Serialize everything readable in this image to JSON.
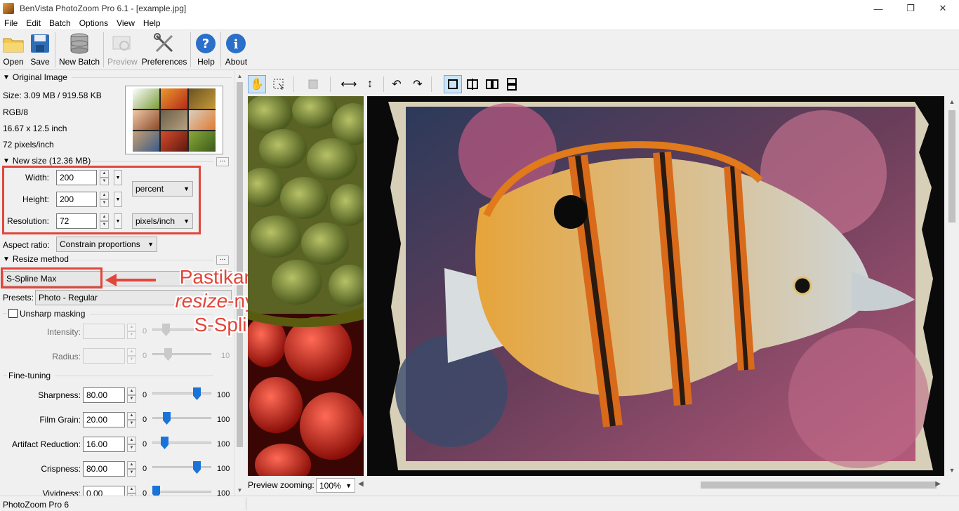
{
  "window": {
    "title": "BenVista PhotoZoom Pro 6.1 - [example.jpg]",
    "minimize": "—",
    "maximize": "❐",
    "close": "✕"
  },
  "menu": [
    "File",
    "Edit",
    "Batch",
    "Options",
    "View",
    "Help"
  ],
  "toolbar": {
    "open": "Open",
    "save": "Save",
    "new_batch": "New Batch",
    "preview": "Preview",
    "preferences": "Preferences",
    "help": "Help",
    "about": "About"
  },
  "original": {
    "header": "Original Image",
    "size": "Size: 3.09 MB / 919.58 KB",
    "mode": "RGB/8",
    "dims": "16.67 x 12.5 inch",
    "res": "72 pixels/inch"
  },
  "newsize": {
    "header": "New size (12.36 MB)",
    "width_label": "Width:",
    "width_value": "200",
    "height_label": "Height:",
    "height_value": "200",
    "res_label": "Resolution:",
    "res_value": "72",
    "unit": "percent",
    "res_unit": "pixels/inch",
    "aspect_label": "Aspect ratio:",
    "aspect_value": "Constrain proportions"
  },
  "resize": {
    "header": "Resize method",
    "method": "S-Spline Max",
    "presets_label": "Presets:",
    "presets_value": "Photo - Regular"
  },
  "unsharp": {
    "label": "Unsharp masking",
    "intensity_label": "Intensity:",
    "intensity_min": "0",
    "radius_label": "Radius:",
    "radius_min": "0",
    "radius_max": "10"
  },
  "finetune": {
    "header": "Fine-tuning",
    "rows": [
      {
        "label": "Sharpness:",
        "value": "80.00",
        "min": "0",
        "max": "100",
        "level": 0.8
      },
      {
        "label": "Film Grain:",
        "value": "20.00",
        "min": "0",
        "max": "100",
        "level": 0.2
      },
      {
        "label": "Artifact Reduction:",
        "value": "16.00",
        "min": "0",
        "max": "100",
        "level": 0.16
      },
      {
        "label": "Crispness:",
        "value": "80.00",
        "min": "0",
        "max": "100",
        "level": 0.8
      },
      {
        "label": "Vividness:",
        "value": "0.00",
        "min": "0",
        "max": "100",
        "level": 0.0
      }
    ]
  },
  "annotation": {
    "line1": "Pastikan metode",
    "line2_italic": "resize",
    "line2_rest": "-nya adalah",
    "line3": "S-Spline Max"
  },
  "preview": {
    "zoom_label": "Preview zooming:",
    "zoom_value": "100%"
  },
  "status": {
    "text": "PhotoZoom Pro 6"
  },
  "colors": {
    "accent": "#1a73d9",
    "annotation": "#e1463c"
  }
}
